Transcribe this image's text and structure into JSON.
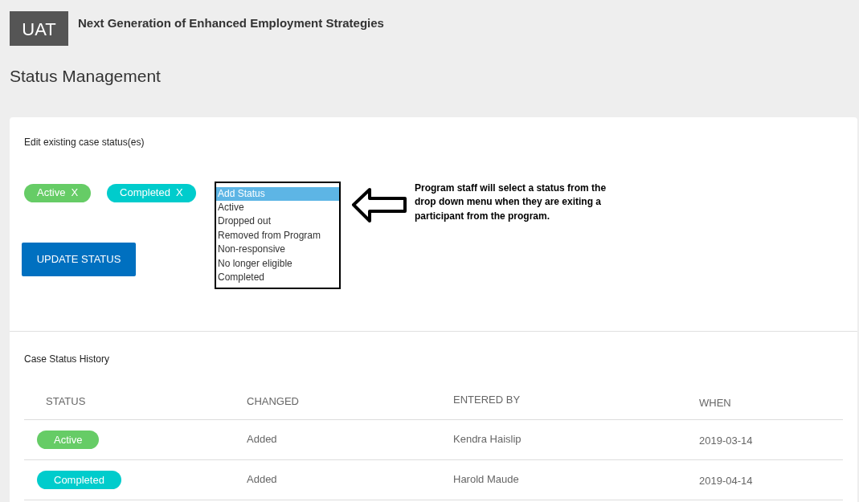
{
  "header": {
    "logo": "UAT",
    "title": "Next Generation of Enhanced Employment Strategies"
  },
  "page_title": "Status Management",
  "edit_section": {
    "title": "Edit existing case status(es)",
    "tags": [
      {
        "label": "Active",
        "remove": "X",
        "color": "#66cc66"
      },
      {
        "label": "Completed",
        "remove": "X",
        "color": "#00cccc"
      }
    ],
    "update_button": "UPDATE STATUS",
    "status_list": [
      {
        "label": "Add Status",
        "selected": true
      },
      {
        "label": "Active",
        "selected": false
      },
      {
        "label": "Dropped out",
        "selected": false
      },
      {
        "label": "Removed from Program",
        "selected": false
      },
      {
        "label": "Non-responsive",
        "selected": false
      },
      {
        "label": "No longer eligible",
        "selected": false
      },
      {
        "label": "Completed",
        "selected": false
      }
    ],
    "annotation": "Program staff will select a status from the drop down menu when they are exiting a participant from the program."
  },
  "history": {
    "title": "Case Status History",
    "columns": [
      "STATUS",
      "CHANGED",
      "ENTERED BY",
      "WHEN"
    ],
    "rows": [
      {
        "status": "Active",
        "color": "#66cc66",
        "changed": "Added",
        "entered_by": "Kendra Haislip",
        "when": "2019-03-14"
      },
      {
        "status": "Completed",
        "color": "#00cccc",
        "changed": "Added",
        "entered_by": "Harold Maude",
        "when": "2019-04-14"
      }
    ]
  }
}
